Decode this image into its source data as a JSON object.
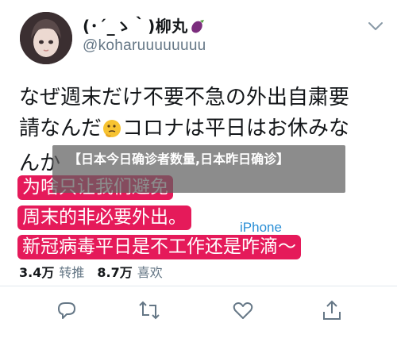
{
  "user": {
    "display_name": "(･´_ゝ｀)柳丸",
    "handle": "@koharuuuuuuuu"
  },
  "tweet": {
    "line1": "なぜ週末だけ不要不急の外出自粛要",
    "line2a": "請なんだ",
    "line2b": "コロナは平日はお休みな",
    "line3": "んか"
  },
  "overlay": {
    "title": "【日本今日确诊者数量,日本昨日确诊】"
  },
  "translation": {
    "line1": "为啥只让我们避免",
    "line2": "周末的非必要外出。",
    "line3": "新冠病毒平日是不工作还是咋滴～",
    "source": "iPhone"
  },
  "stats": {
    "retweets_value": "3.4万",
    "retweets_label": "转推",
    "likes_value": "8.7万",
    "likes_label": "喜欢"
  },
  "colors": {
    "translation_bg": "#e51a5a",
    "source_link": "#2b8fd6",
    "icon_gray": "#657786"
  },
  "icons": [
    "chevron-down-icon",
    "reply-icon",
    "retweet-icon",
    "like-icon",
    "share-icon",
    "eggplant-emoji-icon",
    "thinking-face-emoji-icon"
  ]
}
